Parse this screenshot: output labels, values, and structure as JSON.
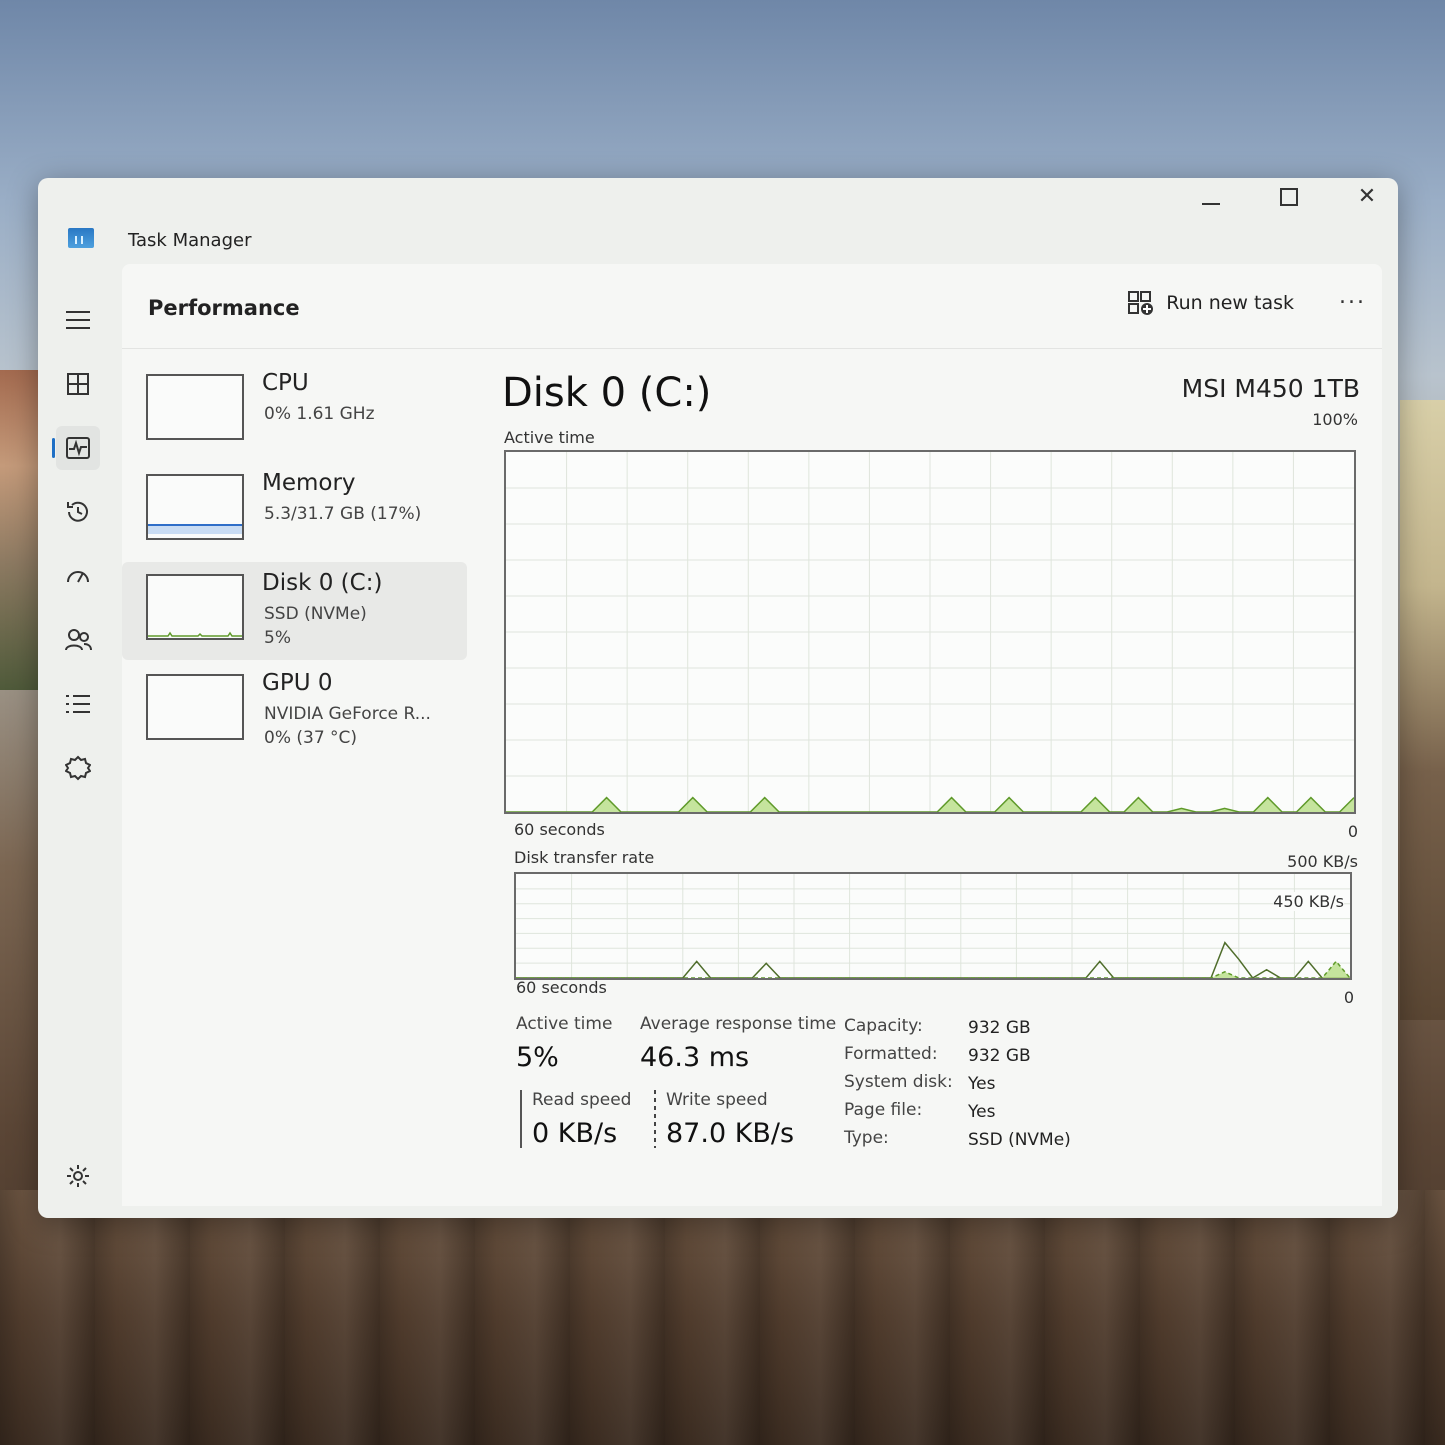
{
  "window": {
    "title": "Task Manager",
    "controls": {
      "minimize": "minimize",
      "maximize": "maximize",
      "close": "close"
    }
  },
  "nav": {
    "items": [
      {
        "icon": "hamburger-icon"
      },
      {
        "icon": "processes-icon"
      },
      {
        "icon": "performance-icon"
      },
      {
        "icon": "app-history-icon"
      },
      {
        "icon": "startup-apps-icon"
      },
      {
        "icon": "users-icon"
      },
      {
        "icon": "details-icon"
      },
      {
        "icon": "services-icon"
      },
      {
        "icon": "settings-icon"
      }
    ],
    "active_index": 2
  },
  "header": {
    "page_title": "Performance",
    "run_task_label": "Run new task",
    "more_label": "..."
  },
  "devices": [
    {
      "name": "CPU",
      "line1": "0% 1.61 GHz",
      "line2": ""
    },
    {
      "name": "Memory",
      "line1": "5.3/31.7 GB (17%)",
      "line2": ""
    },
    {
      "name": "Disk 0 (C:)",
      "line1": "SSD (NVMe)",
      "line2": "5%"
    },
    {
      "name": "GPU 0",
      "line1": "NVIDIA GeForce R...",
      "line2": "0% (37 °C)"
    }
  ],
  "selected_device": 2,
  "disk": {
    "title": "Disk 0 (C:)",
    "model": "MSI M450 1TB",
    "active_graph": {
      "label": "Active time",
      "max_label": "100%",
      "left_axis": "60 seconds",
      "right_axis": "0"
    },
    "transfer_graph": {
      "label": "Disk transfer rate",
      "max_label": "500 KB/s",
      "inner_label": "450 KB/s",
      "left_axis": "60 seconds",
      "right_axis": "0"
    },
    "stats": {
      "active_time_label": "Active time",
      "active_time_value": "5%",
      "avg_response_label": "Average response time",
      "avg_response_value": "46.3 ms",
      "read_label": "Read speed",
      "read_value": "0 KB/s",
      "write_label": "Write speed",
      "write_value": "87.0 KB/s"
    },
    "properties": [
      {
        "key": "Capacity:",
        "value": "932 GB"
      },
      {
        "key": "Formatted:",
        "value": "932 GB"
      },
      {
        "key": "System disk:",
        "value": "Yes"
      },
      {
        "key": "Page file:",
        "value": "Yes"
      },
      {
        "key": "Type:",
        "value": "SSD (NVMe)"
      }
    ]
  },
  "colors": {
    "disk_green_fill": "#b8dd86",
    "disk_green_line": "#5f9a2a",
    "memory_line": "#2f6ec8"
  },
  "chart_data": [
    {
      "type": "area",
      "title": "Active time",
      "xlabel": "60 seconds",
      "ylabel": "",
      "xlim": [
        60,
        0
      ],
      "ylim": [
        0,
        100
      ],
      "series": [
        {
          "values": [
            0,
            0,
            0,
            0,
            0,
            0,
            0,
            4,
            0,
            0,
            0,
            0,
            0,
            4,
            0,
            0,
            0,
            0,
            4,
            0,
            0,
            0,
            0,
            0,
            0,
            0,
            0,
            0,
            0,
            0,
            0,
            4,
            0,
            0,
            0,
            4,
            0,
            0,
            0,
            0,
            0,
            4,
            0,
            0,
            4,
            0,
            0,
            1,
            0,
            0,
            1,
            0,
            0,
            4,
            0,
            0,
            4,
            0,
            0,
            4
          ]
        }
      ]
    },
    {
      "type": "line",
      "title": "Disk transfer rate",
      "xlabel": "60 seconds",
      "ylabel": "",
      "xlim": [
        60,
        0
      ],
      "ylim": [
        0,
        500
      ],
      "series": [
        {
          "name": "Read speed",
          "values": [
            0,
            0,
            0,
            0,
            0,
            0,
            0,
            0,
            0,
            0,
            0,
            0,
            0,
            80,
            0,
            0,
            0,
            0,
            70,
            0,
            0,
            0,
            0,
            0,
            0,
            0,
            0,
            0,
            0,
            0,
            0,
            0,
            0,
            0,
            0,
            0,
            0,
            0,
            0,
            0,
            0,
            0,
            80,
            0,
            0,
            0,
            0,
            0,
            0,
            0,
            0,
            170,
            90,
            0,
            40,
            0,
            0,
            80,
            0,
            0,
            0
          ]
        },
        {
          "name": "Write speed",
          "values": [
            0,
            0,
            0,
            0,
            0,
            0,
            0,
            0,
            0,
            0,
            0,
            0,
            0,
            0,
            0,
            0,
            0,
            0,
            0,
            0,
            0,
            0,
            0,
            0,
            0,
            0,
            0,
            0,
            0,
            0,
            0,
            0,
            0,
            0,
            0,
            0,
            0,
            0,
            0,
            0,
            0,
            0,
            0,
            0,
            0,
            0,
            0,
            0,
            0,
            0,
            0,
            30,
            0,
            0,
            0,
            0,
            0,
            0,
            0,
            80,
            0
          ]
        }
      ]
    }
  ]
}
